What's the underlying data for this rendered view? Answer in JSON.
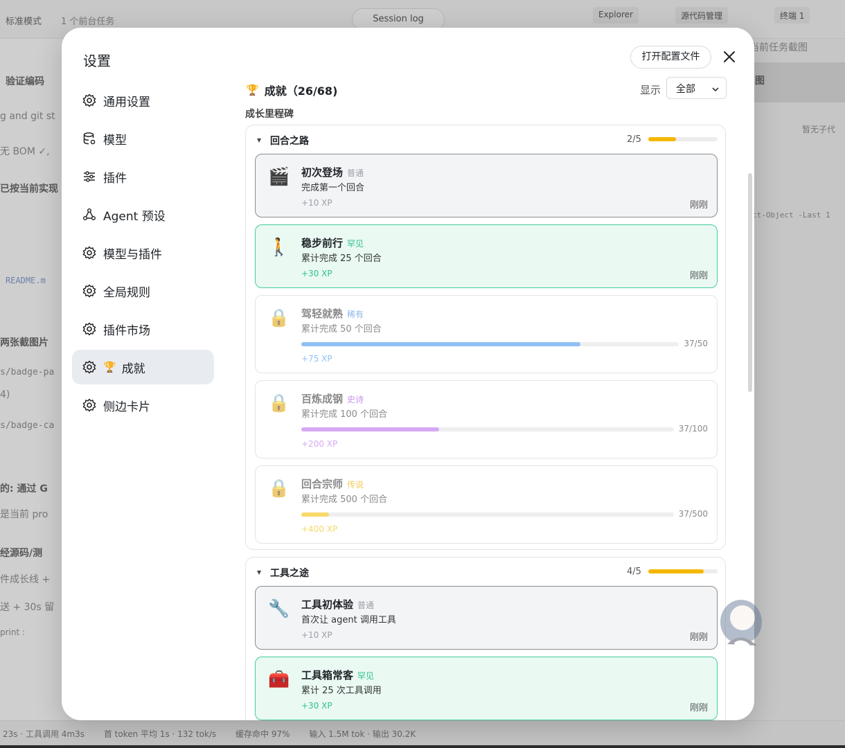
{
  "background": {
    "mode": "标准模式",
    "task": "1 个前台任务",
    "session": "Session log",
    "tabs": [
      "Explorer",
      "源代码管理",
      "终端 1"
    ],
    "snippets": [
      "验证编码",
      "g and git st",
      "无 BOM ✓,",
      "已按当前实现",
      "README.m",
      "两张截图片",
      "s/badge-pa",
      "4)",
      "s/badge-ca",
      "的: 通过 G",
      "是当前 pro",
      "经源码/测",
      "件成长线 +",
      "送 + 30s 留",
      "print :",
      "当前任务截图",
      "图",
      "暂无子代",
      "ct-Object -Last 1"
    ],
    "status_bar": [
      "23s · 工具调用 4m3s",
      "首 token 平均 1s · 132 tok/s",
      "缓存命中 97%",
      "输入 1.5M tok · 输出 30.2K"
    ]
  },
  "modal": {
    "title": "设置",
    "open_config_label": "打开配置文件",
    "close_icon": "close-icon"
  },
  "sidebar": {
    "items": [
      {
        "label": "通用设置",
        "icon": "gear-icon"
      },
      {
        "label": "模型",
        "icon": "database-icon"
      },
      {
        "label": "插件",
        "icon": "sliders-icon"
      },
      {
        "label": "Agent 预设",
        "icon": "network-icon"
      },
      {
        "label": "模型与插件",
        "icon": "gear-icon"
      },
      {
        "label": "全局规则",
        "icon": "gear-icon"
      },
      {
        "label": "插件市场",
        "icon": "gear-icon"
      },
      {
        "label": "成就",
        "icon": "gear-icon",
        "active": true,
        "emoji": "🏆"
      },
      {
        "label": "侧边卡片",
        "icon": "gear-icon"
      }
    ]
  },
  "content": {
    "header_emoji": "🏆",
    "header_title": "成就（26/68)",
    "show_label": "显示",
    "show_value": "全部",
    "section_title": "成长里程碑",
    "groups": [
      {
        "name": "回合之路",
        "count": "2/5",
        "progress": 0.4,
        "cards": [
          {
            "emoji": "🎬",
            "name": "初次登场",
            "rarity": "普通",
            "desc": "完成第一个回合",
            "xp": "+10 XP",
            "time": "刚刚",
            "state": "common"
          },
          {
            "emoji": "🚶",
            "name": "稳步前行",
            "rarity": "罕见",
            "desc": "累计完成 25 个回合",
            "xp": "+30 XP",
            "time": "刚刚",
            "state": "rare"
          },
          {
            "emoji": "🔒",
            "name": "驾轻就熟",
            "rarity": "稀有",
            "desc": "累计完成 50 个回合",
            "xp": "+75 XP",
            "progress_text": "37/50",
            "progress": 0.74,
            "state": "locked"
          },
          {
            "emoji": "🔒",
            "name": "百炼成钢",
            "rarity": "史诗",
            "desc": "累计完成 100 个回合",
            "xp": "+200 XP",
            "progress_text": "37/100",
            "progress": 0.37,
            "state": "locked"
          },
          {
            "emoji": "🔒",
            "name": "回合宗师",
            "rarity": "传说",
            "desc": "累计完成 500 个回合",
            "xp": "+400 XP",
            "progress_text": "37/500",
            "progress": 0.074,
            "state": "locked"
          }
        ]
      },
      {
        "name": "工具之途",
        "count": "4/5",
        "progress": 0.8,
        "cards": [
          {
            "emoji": "🔧",
            "name": "工具初体验",
            "rarity": "普通",
            "desc": "首次让 agent 调用工具",
            "xp": "+10 XP",
            "time": "刚刚",
            "state": "common"
          },
          {
            "emoji": "🧰",
            "name": "工具箱常客",
            "rarity": "罕见",
            "desc": "累计 25 次工具调用",
            "xp": "+30 XP",
            "time": "刚刚",
            "state": "rare"
          }
        ]
      }
    ]
  },
  "colors": {
    "common_text": "#9aa0a6",
    "rare": "#2fbf8f",
    "rarity_rare_locked": "#8ab8ea",
    "rarity_epic": "#c596ee",
    "rarity_legend": "#f2cb5a",
    "bar_rare": "#8ec0f5",
    "bar_epic": "#d7a9f5",
    "bar_legend": "#f7d86a",
    "group_bar": "#f5b700"
  }
}
